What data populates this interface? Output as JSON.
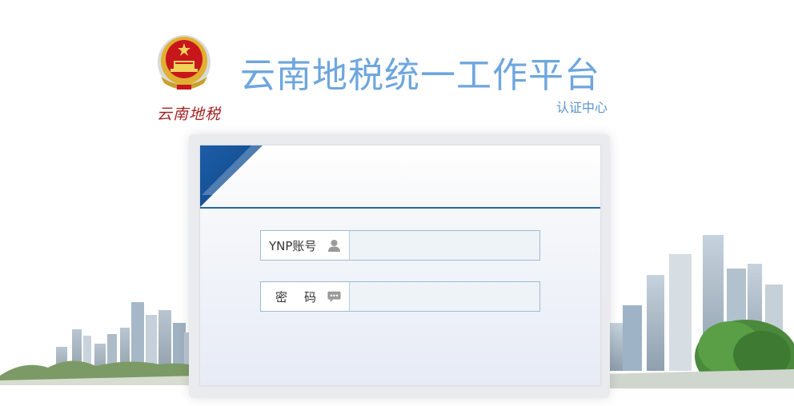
{
  "header": {
    "emblem_caption": "云南地税",
    "title": "云南地税统一工作平台",
    "subtitle": "认证中心"
  },
  "login": {
    "account_label": "YNP账号",
    "account_value": "",
    "password_label": "密码",
    "password_value": ""
  },
  "icons": {
    "account": "user-icon",
    "password": "speech-bubble-icon",
    "emblem": "national-emblem-icon"
  },
  "colors": {
    "title": "#6ea6de",
    "accent_blue": "#1f5fa6",
    "emblem_red": "#c8161d",
    "emblem_gold": "#e0b030"
  }
}
